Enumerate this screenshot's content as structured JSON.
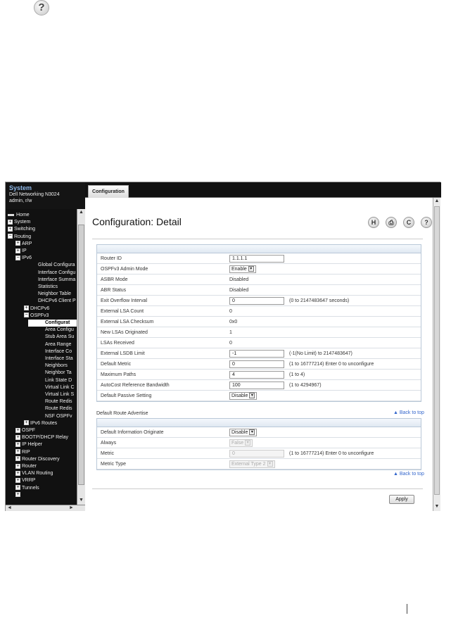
{
  "top_icon": "help-icon",
  "header": {
    "system": "System",
    "device": "Dell Networking N3024",
    "user": "admin, r/w"
  },
  "tab": {
    "label": "Configuration"
  },
  "page": {
    "title": "Configuration: Detail"
  },
  "toolbar_icons": [
    "save-icon",
    "print-icon",
    "refresh-icon",
    "help-icon"
  ],
  "toolbar_glyphs": [
    "H",
    "⎙",
    "C",
    "?"
  ],
  "nav": [
    {
      "label": "Home",
      "indent": 0,
      "sign": "",
      "bar": true
    },
    {
      "label": "System",
      "indent": 0,
      "sign": "+"
    },
    {
      "label": "Switching",
      "indent": 0,
      "sign": "+"
    },
    {
      "label": "Routing",
      "indent": 0,
      "sign": "−"
    },
    {
      "label": "ARP",
      "indent": 1,
      "sign": "+"
    },
    {
      "label": "IP",
      "indent": 1,
      "sign": "+"
    },
    {
      "label": "IPv6",
      "indent": 1,
      "sign": "−"
    },
    {
      "label": "Global Configura",
      "indent": 2,
      "sign": ""
    },
    {
      "label": "Interface Configu",
      "indent": 2,
      "sign": ""
    },
    {
      "label": "Interface Summa",
      "indent": 2,
      "sign": ""
    },
    {
      "label": "Statistics",
      "indent": 2,
      "sign": ""
    },
    {
      "label": "Neighbor Table",
      "indent": 2,
      "sign": ""
    },
    {
      "label": "DHCPv6 Client P",
      "indent": 2,
      "sign": ""
    },
    {
      "label": "DHCPv6",
      "indent": 2,
      "sign": "+",
      "alt": true
    },
    {
      "label": "OSPFv3",
      "indent": 2,
      "sign": "−",
      "alt": true
    },
    {
      "label": "Configurat",
      "indent": 3,
      "sign": "",
      "selected": true
    },
    {
      "label": "Area Configu",
      "indent": 3,
      "sign": ""
    },
    {
      "label": "Stub Area Su",
      "indent": 3,
      "sign": ""
    },
    {
      "label": "Area Range",
      "indent": 3,
      "sign": ""
    },
    {
      "label": "Interface Co",
      "indent": 3,
      "sign": ""
    },
    {
      "label": "Interface Sta",
      "indent": 3,
      "sign": ""
    },
    {
      "label": "Neighbors",
      "indent": 3,
      "sign": ""
    },
    {
      "label": "Neighbor Ta",
      "indent": 3,
      "sign": ""
    },
    {
      "label": "Link State D",
      "indent": 3,
      "sign": ""
    },
    {
      "label": "Virtual Link C",
      "indent": 3,
      "sign": ""
    },
    {
      "label": "Virtual Link S",
      "indent": 3,
      "sign": ""
    },
    {
      "label": "Route Redis",
      "indent": 3,
      "sign": ""
    },
    {
      "label": "Route Redis",
      "indent": 3,
      "sign": ""
    },
    {
      "label": "NSF OSPFv",
      "indent": 3,
      "sign": ""
    },
    {
      "label": "IPv6 Routes",
      "indent": 2,
      "sign": "+",
      "alt": true
    },
    {
      "label": "OSPF",
      "indent": 1,
      "sign": "+"
    },
    {
      "label": "BOOTP/DHCP Relay",
      "indent": 1,
      "sign": "+"
    },
    {
      "label": "IP Helper",
      "indent": 1,
      "sign": "+"
    },
    {
      "label": "RIP",
      "indent": 1,
      "sign": "+"
    },
    {
      "label": "Router Discovery",
      "indent": 1,
      "sign": "+"
    },
    {
      "label": "Router",
      "indent": 1,
      "sign": "+"
    },
    {
      "label": "VLAN Routing",
      "indent": 1,
      "sign": "+"
    },
    {
      "label": "VRRP",
      "indent": 1,
      "sign": "+"
    },
    {
      "label": "Tunnels",
      "indent": 1,
      "sign": "+"
    },
    {
      "label": "",
      "indent": 1,
      "sign": "+"
    }
  ],
  "config_rows": [
    {
      "label": "Router ID",
      "type": "text",
      "value": "1.1.1.1"
    },
    {
      "label": "OSPFv3 Admin Mode",
      "type": "select",
      "value": "Enable"
    },
    {
      "label": "ASBR Mode",
      "type": "static",
      "value": "Disabled"
    },
    {
      "label": "ABR Status",
      "type": "static",
      "value": "Disabled"
    },
    {
      "label": "Exit Overflow Interval",
      "type": "text",
      "value": "0",
      "hint": "(0 to 2147483647 seconds)"
    },
    {
      "label": "External LSA Count",
      "type": "static",
      "value": "0"
    },
    {
      "label": "External LSA Checksum",
      "type": "static",
      "value": "0x0"
    },
    {
      "label": "New LSAs Originated",
      "type": "static",
      "value": "1"
    },
    {
      "label": "LSAs Received",
      "type": "static",
      "value": "0"
    },
    {
      "label": "External LSDB Limit",
      "type": "text",
      "value": "-1",
      "hint": "(-1(No Limit) to 2147483647)"
    },
    {
      "label": "Default Metric",
      "type": "text",
      "value": "0",
      "hint": "(1 to 16777214) Enter 0 to unconfigure"
    },
    {
      "label": "Maximum Paths",
      "type": "text",
      "value": "4",
      "hint": "(1 to 4)"
    },
    {
      "label": "AutoCost Reference Bandwidth",
      "type": "text",
      "value": "100",
      "hint": "(1 to 4294967)"
    },
    {
      "label": "Default Passive Setting",
      "type": "select",
      "value": "Disable"
    }
  ],
  "section2": {
    "title": "Default Route Advertise"
  },
  "back_to_top": "Back to top",
  "route_rows": [
    {
      "label": "Default Information Originate",
      "type": "select",
      "value": "Disable"
    },
    {
      "label": "Always",
      "type": "select",
      "value": "False",
      "disabled": true
    },
    {
      "label": "Metric",
      "type": "text",
      "value": "0",
      "disabled": true,
      "hint": "(1 to 16777214) Enter 0 to unconfigure"
    },
    {
      "label": "Metric Type",
      "type": "select",
      "value": "External Type 2",
      "disabled": true
    }
  ],
  "apply_label": "Apply"
}
